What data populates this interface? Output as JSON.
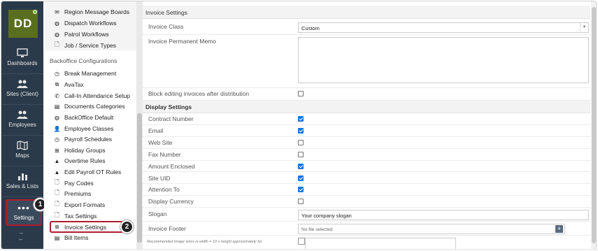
{
  "user": {
    "initials": "DD"
  },
  "rail": {
    "items": [
      {
        "label": "Dashboards",
        "icon": "monitor-icon"
      },
      {
        "label": "Sites (Client)",
        "icon": "people-icon"
      },
      {
        "label": "Employees",
        "icon": "people-icon"
      },
      {
        "label": "Maps",
        "icon": "map-icon"
      },
      {
        "label": "Sales & Lists",
        "icon": "chart-icon"
      }
    ],
    "settings_label": "Settings",
    "settings_dots": "•••"
  },
  "callouts": {
    "one": "1",
    "two": "2"
  },
  "nav": {
    "top_items": [
      {
        "label": "Region Message Boards",
        "icon": "envelope-icon"
      },
      {
        "label": "Dispatch Workflows",
        "icon": "globe-icon"
      },
      {
        "label": "Patrol Workflows",
        "icon": "globe-icon"
      },
      {
        "label": "Job / Service Types",
        "icon": "document-icon"
      }
    ],
    "section_title": "Backoffice Configurations",
    "items": [
      {
        "label": "Break Management",
        "icon": "clock-icon"
      },
      {
        "label": "AvaTax",
        "icon": "copy-icon"
      },
      {
        "label": "Call-In Attendance Setup",
        "icon": "phone-icon"
      },
      {
        "label": "Documents Categories",
        "icon": "file-icon"
      },
      {
        "label": "BackOffice Default",
        "icon": "globe-icon"
      },
      {
        "label": "Employee Classes",
        "icon": "person-icon"
      },
      {
        "label": "Payroll Schedules",
        "icon": "clock-icon"
      },
      {
        "label": "Holiday Groups",
        "icon": "gift-icon"
      },
      {
        "label": "Overtime Rules",
        "icon": "warning-icon"
      },
      {
        "label": "Edit Payroll OT Rules",
        "icon": "warning-icon"
      },
      {
        "label": "Pay Codes",
        "icon": "document-icon"
      },
      {
        "label": "Premiums",
        "icon": "document-icon"
      },
      {
        "label": "Export Formats",
        "icon": "document-icon"
      },
      {
        "label": "Tax Settings",
        "icon": "document-icon"
      },
      {
        "label": "Invoice Settings",
        "icon": "copy-icon"
      },
      {
        "label": "Bill Items",
        "icon": "file-icon"
      }
    ]
  },
  "main": {
    "invoice_section": "Invoice Settings",
    "invoice_class_label": "Invoice Class",
    "invoice_class_value": "Custom",
    "permanent_memo_label": "Invoice Permanent Memo",
    "block_editing_label": "Block editing invoices after distribution",
    "display_section": "Display Settings",
    "display_rows": [
      {
        "label": "Contract Number",
        "checked": true
      },
      {
        "label": "Email",
        "checked": true
      },
      {
        "label": "Web Site",
        "checked": false
      },
      {
        "label": "Fax Number",
        "checked": false
      },
      {
        "label": "Amount Enclosed",
        "checked": true
      },
      {
        "label": "Site UID",
        "checked": true
      },
      {
        "label": "Attention To",
        "checked": true
      },
      {
        "label": "Display Currency",
        "checked": false
      }
    ],
    "slogan_label": "Slogan",
    "slogan_value": "Your company slogan",
    "footer_label": "Invoice Footer",
    "footer_file": "No file selected",
    "footer_add": "+",
    "image_note": "Recommended image sizes is width = 10 x height approximately for"
  },
  "colors": {
    "rail": "#2b3a4a",
    "accent": "#b01c2e",
    "checkbox": "#1e73d8",
    "avatar": "#5a6e1f"
  }
}
